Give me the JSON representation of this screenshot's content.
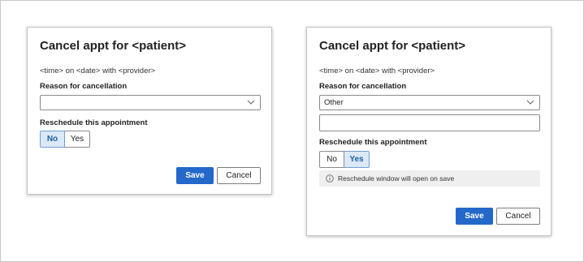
{
  "dialogs": [
    {
      "title": "Cancel appt for <patient>",
      "meta": "<time> on <date> with <provider>",
      "reason_label": "Reason for cancellation",
      "reason_value": "",
      "reschedule_label": "Reschedule this appointment",
      "options": [
        "No",
        "Yes"
      ],
      "selected": "No",
      "save_label": "Save",
      "cancel_label": "Cancel"
    },
    {
      "title": "Cancel appt for <patient>",
      "meta": "<time> on <date> with <provider>",
      "reason_label": "Reason for cancellation",
      "reason_value": "Other",
      "other_text_value": "",
      "reschedule_label": "Reschedule this appointment",
      "options": [
        "No",
        "Yes"
      ],
      "selected": "Yes",
      "banner_text": "Reschedule window will open on save",
      "banner_icon": "info-icon",
      "save_label": "Save",
      "cancel_label": "Cancel"
    }
  ],
  "colors": {
    "primary": "#2468c9",
    "selected_bg": "#dbe8f6",
    "selected_text": "#1f5fa8",
    "banner_bg": "#efefef"
  }
}
